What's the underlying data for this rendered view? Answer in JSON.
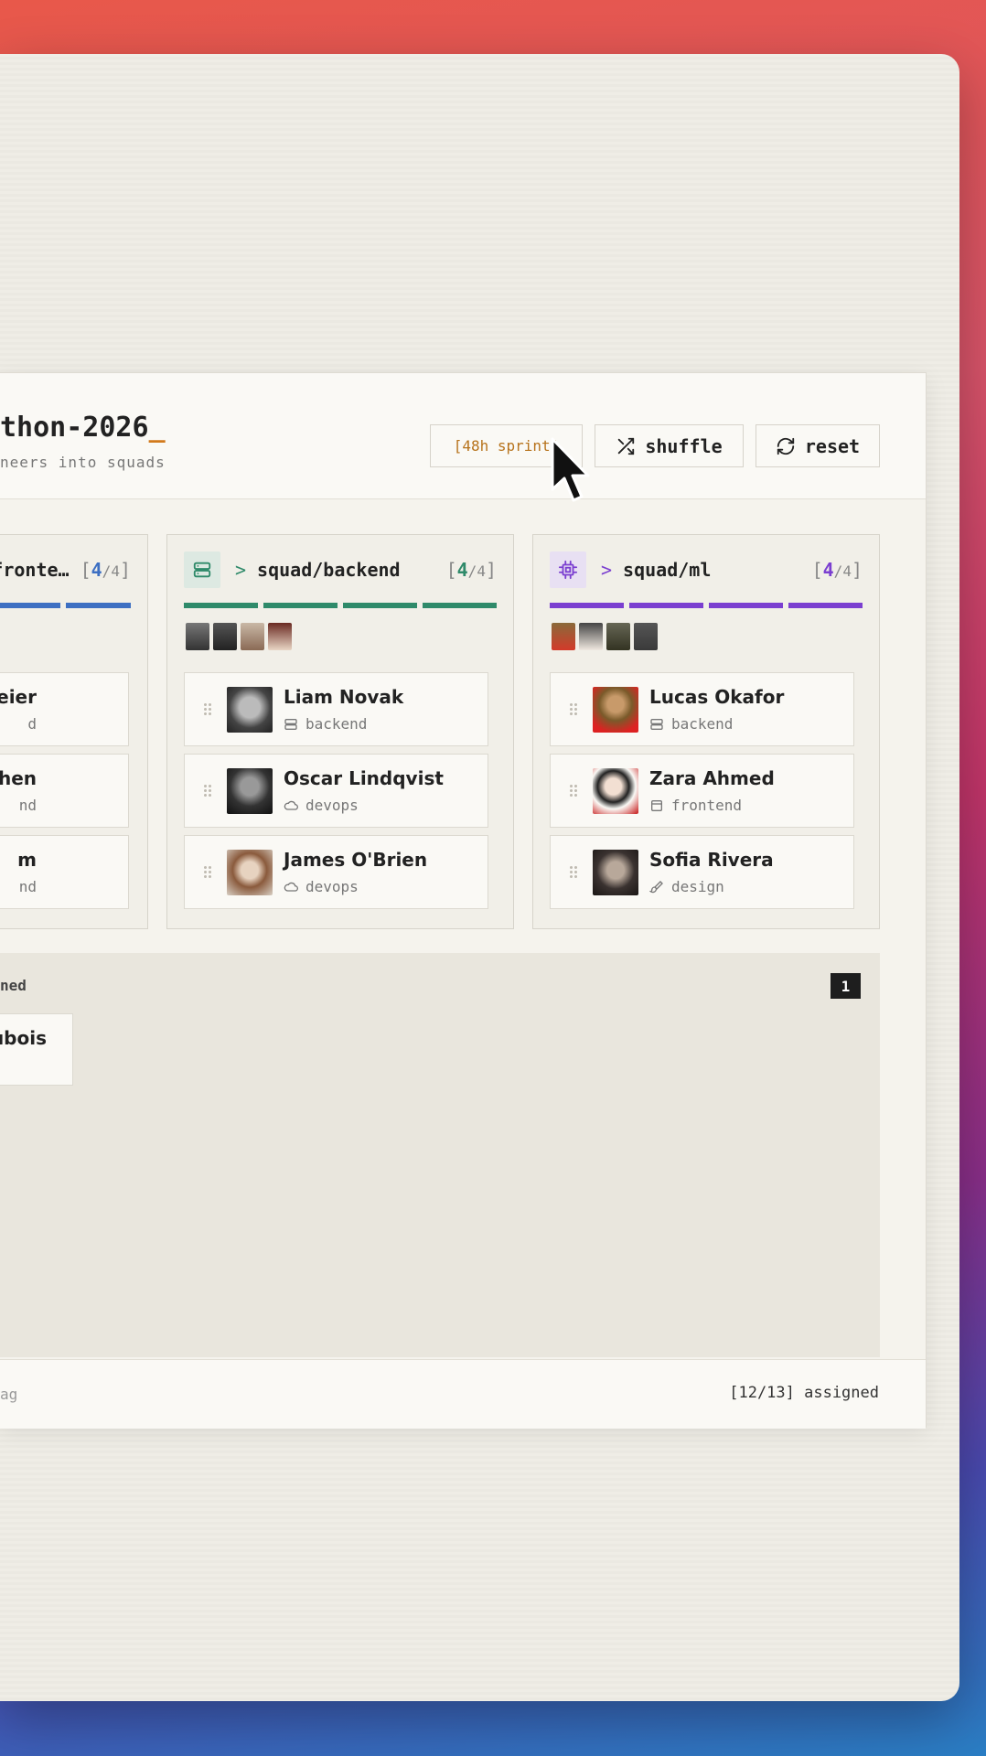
{
  "header": {
    "title": "thon-2026",
    "title_caret": "_",
    "subtitle": "neers into squads",
    "sprint_label": "[48h sprint]",
    "shuffle_label": "shuffle",
    "reset_label": "reset"
  },
  "colors": {
    "frontend": "#3d6fc2",
    "backend": "#2f8a6a",
    "ml": "#7b3fd0",
    "accent_caret": "#d27a1c"
  },
  "columns": [
    {
      "id": "frontend",
      "prompt": ">",
      "name": "squad/fronte…",
      "count": "4",
      "capacity": "4",
      "filled_bars": 4,
      "icon": "layout-icon",
      "members": [
        {
          "name": "eier",
          "role": "d",
          "role_icon": "server-icon"
        },
        {
          "name": "hen",
          "role": "nd",
          "role_icon": "server-icon"
        },
        {
          "name": "m",
          "role": "nd",
          "role_icon": "server-icon"
        }
      ]
    },
    {
      "id": "backend",
      "prompt": ">",
      "name": "squad/backend",
      "count": "4",
      "capacity": "4",
      "filled_bars": 4,
      "icon": "server-icon",
      "members": [
        {
          "name": "Liam Novak",
          "role": "backend",
          "role_icon": "server-icon"
        },
        {
          "name": "Oscar Lindqvist",
          "role": "devops",
          "role_icon": "cloud-icon"
        },
        {
          "name": "James O'Brien",
          "role": "devops",
          "role_icon": "cloud-icon"
        }
      ]
    },
    {
      "id": "ml",
      "prompt": ">",
      "name": "squad/ml",
      "count": "4",
      "capacity": "4",
      "filled_bars": 4,
      "icon": "chip-icon",
      "members": [
        {
          "name": "Lucas Okafor",
          "role": "backend",
          "role_icon": "server-icon"
        },
        {
          "name": "Zara Ahmed",
          "role": "frontend",
          "role_icon": "layout-icon"
        },
        {
          "name": "Sofia Rivera",
          "role": "design",
          "role_icon": "brush-icon"
        }
      ]
    }
  ],
  "pool": {
    "label": "ned",
    "count": "1",
    "card_name": "ubois"
  },
  "footer": {
    "hint": "ag",
    "status": "[12/13] assigned"
  }
}
